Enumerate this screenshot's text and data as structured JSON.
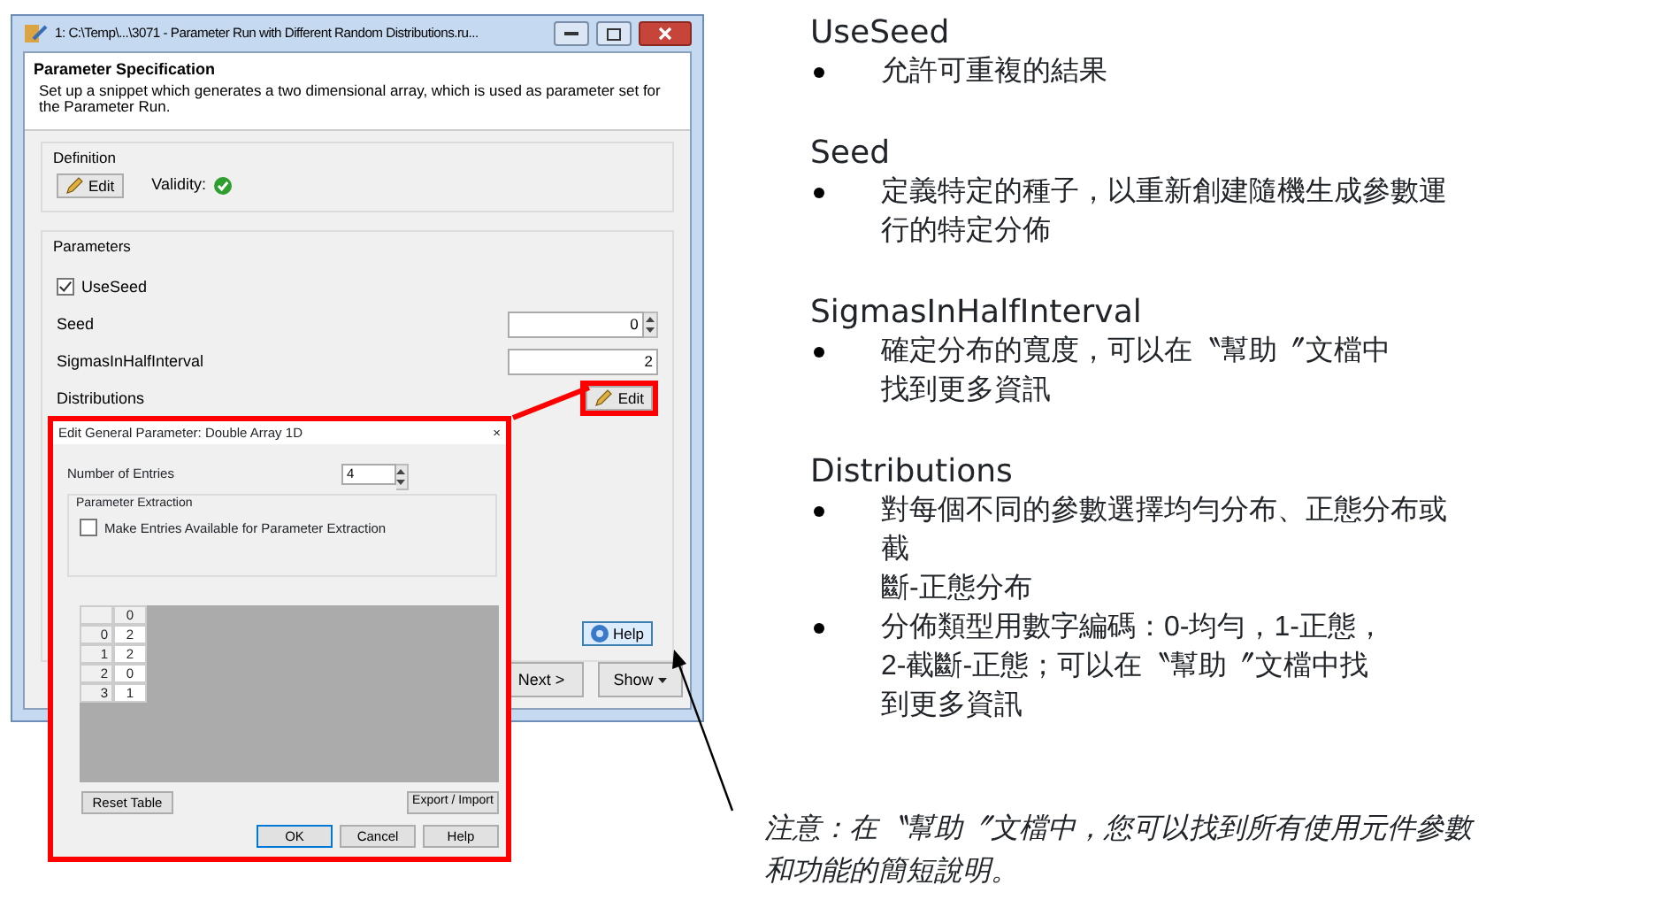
{
  "window": {
    "title": "1: C:\\Temp\\...\\3071 - Parameter Run with Different Random Distributions.ru..."
  },
  "header": {
    "title": "Parameter Specification",
    "description": "Set up a snippet which generates a two dimensional array, which is used as parameter set for the Parameter Run."
  },
  "definition": {
    "legend": "Definition",
    "edit_button": "Edit",
    "validity_label": "Validity:",
    "valid": true
  },
  "parameters": {
    "legend": "Parameters",
    "use_seed": {
      "label": "UseSeed",
      "checked": true
    },
    "fields": [
      {
        "label": "Seed",
        "kind": "spin",
        "value": "0"
      },
      {
        "label": "SigmasInHalfInterval",
        "kind": "text",
        "value": "2"
      },
      {
        "label": "Distributions",
        "kind": "edit",
        "button": "Edit",
        "highlighted": true
      }
    ],
    "help_button": "Help"
  },
  "footer_buttons": [
    {
      "label": "Next >",
      "dropdown": false
    },
    {
      "label": "Show",
      "dropdown": true
    }
  ],
  "dialog": {
    "title": "Edit General Parameter: Double Array 1D",
    "close": "×",
    "entries_label": "Number of Entries",
    "entries_value": "4",
    "extraction": {
      "legend": "Parameter Extraction",
      "checkbox": {
        "label": "Make Entries Available for Parameter Extraction",
        "checked": false
      }
    },
    "table": {
      "columns": [
        "0"
      ],
      "rows": [
        {
          "index": "0",
          "value": "2"
        },
        {
          "index": "1",
          "value": "2"
        },
        {
          "index": "2",
          "value": "0"
        },
        {
          "index": "3",
          "value": "1"
        }
      ]
    },
    "reset_button": "Reset Table",
    "export_button": "Export / Import",
    "action_buttons": [
      {
        "label": "OK",
        "default": true
      },
      {
        "label": "Cancel",
        "default": false
      },
      {
        "label": "Help",
        "default": false
      }
    ]
  },
  "notes": {
    "sections": [
      {
        "heading": "UseSeed",
        "bullets": [
          {
            "lines": [
              "允許可重複的結果"
            ]
          }
        ]
      },
      {
        "heading": "Seed",
        "bullets": [
          {
            "lines": [
              "定義特定的種子，以重新創建隨機生成參數運",
              "行的特定分佈"
            ]
          }
        ]
      },
      {
        "heading": "SigmasInHalfInterval",
        "bullets": [
          {
            "lines": [
              "確定分布的寬度，可以在〝幫助〞文檔中",
              "找到更多資訊"
            ]
          }
        ]
      },
      {
        "heading": "Distributions",
        "bullets": [
          {
            "lines": [
              "對每個不同的參數選擇均勻分布、正態分布或",
              "截",
              "斷-正態分布"
            ]
          },
          {
            "lines": [
              "分佈類型用數字編碼：0-均勻，1-正態，",
              "2-截斷-正態；可以在〝幫助〞文檔中找",
              "到更多資訊"
            ]
          }
        ]
      }
    ],
    "remark": {
      "lines": [
        "注意：在〝幫助〞文檔中，您可以找到所有使用元件參數",
        "和功能的簡短說明。"
      ]
    }
  }
}
